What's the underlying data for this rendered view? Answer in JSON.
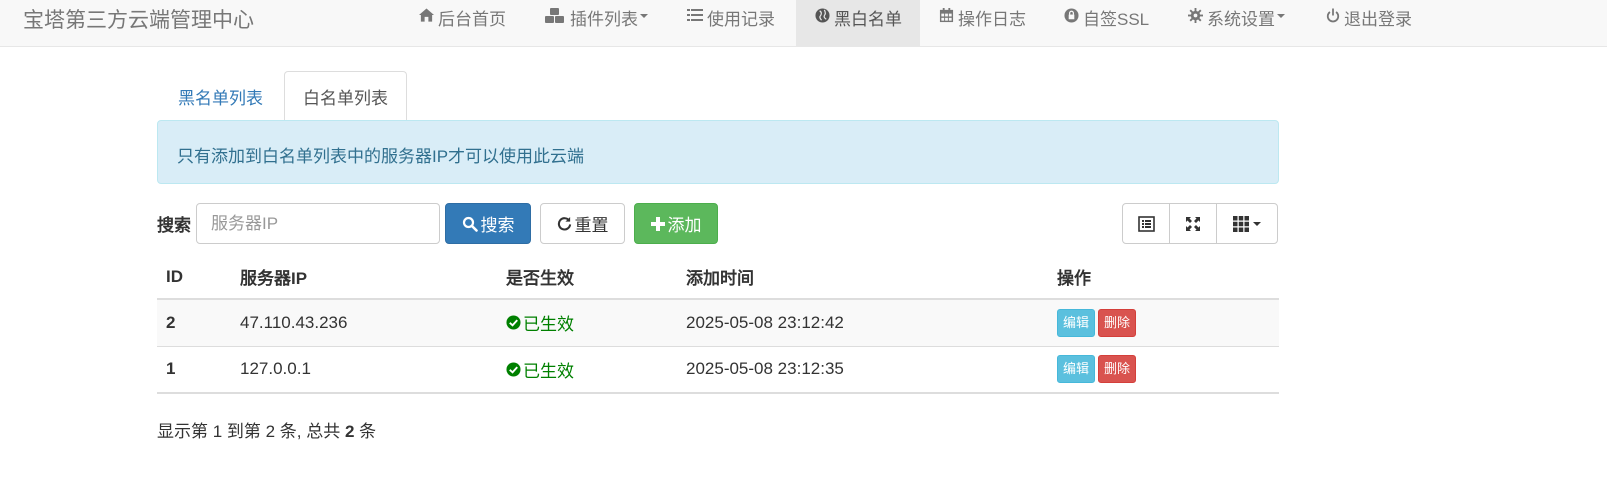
{
  "navbar": {
    "brand": "宝塔第三方云端管理中心",
    "items": [
      {
        "label": "后台首页",
        "icon": "home-icon"
      },
      {
        "label": "插件列表",
        "icon": "cubes-icon",
        "dropdown": true
      },
      {
        "label": "使用记录",
        "icon": "list-icon"
      },
      {
        "label": "黑白名单",
        "icon": "globe-icon",
        "active": true
      },
      {
        "label": "操作日志",
        "icon": "calendar-icon"
      },
      {
        "label": "自签SSL",
        "icon": "lock-icon"
      },
      {
        "label": "系统设置",
        "icon": "gear-icon",
        "dropdown": true
      },
      {
        "label": "退出登录",
        "icon": "power-icon"
      }
    ]
  },
  "tabs": [
    {
      "label": "黑名单列表",
      "active": false
    },
    {
      "label": "白名单列表",
      "active": true
    }
  ],
  "alert": {
    "text": "只有添加到白名单列表中的服务器IP才可以使用此云端"
  },
  "toolbar": {
    "search_label": "搜索",
    "search_placeholder": "服务器IP",
    "search_button": "搜索",
    "reset_button": "重置",
    "add_button": "添加"
  },
  "table": {
    "columns": [
      "ID",
      "服务器IP",
      "是否生效",
      "添加时间",
      "操作"
    ],
    "rows": [
      {
        "id": "2",
        "ip": "47.110.43.236",
        "status": "已生效",
        "time": "2025-05-08 23:12:42",
        "edit": "编辑",
        "delete": "删除"
      },
      {
        "id": "1",
        "ip": "127.0.0.1",
        "status": "已生效",
        "time": "2025-05-08 23:12:35",
        "edit": "编辑",
        "delete": "删除"
      }
    ]
  },
  "pagination": {
    "prefix": "显示第 1 到第 2 条, 总共 ",
    "total": "2",
    "suffix": " 条"
  },
  "colors": {
    "primary": "#337ab7",
    "success": "#5cb85c",
    "info": "#5bc0de",
    "danger": "#d9534f",
    "status_green": "#008000"
  }
}
